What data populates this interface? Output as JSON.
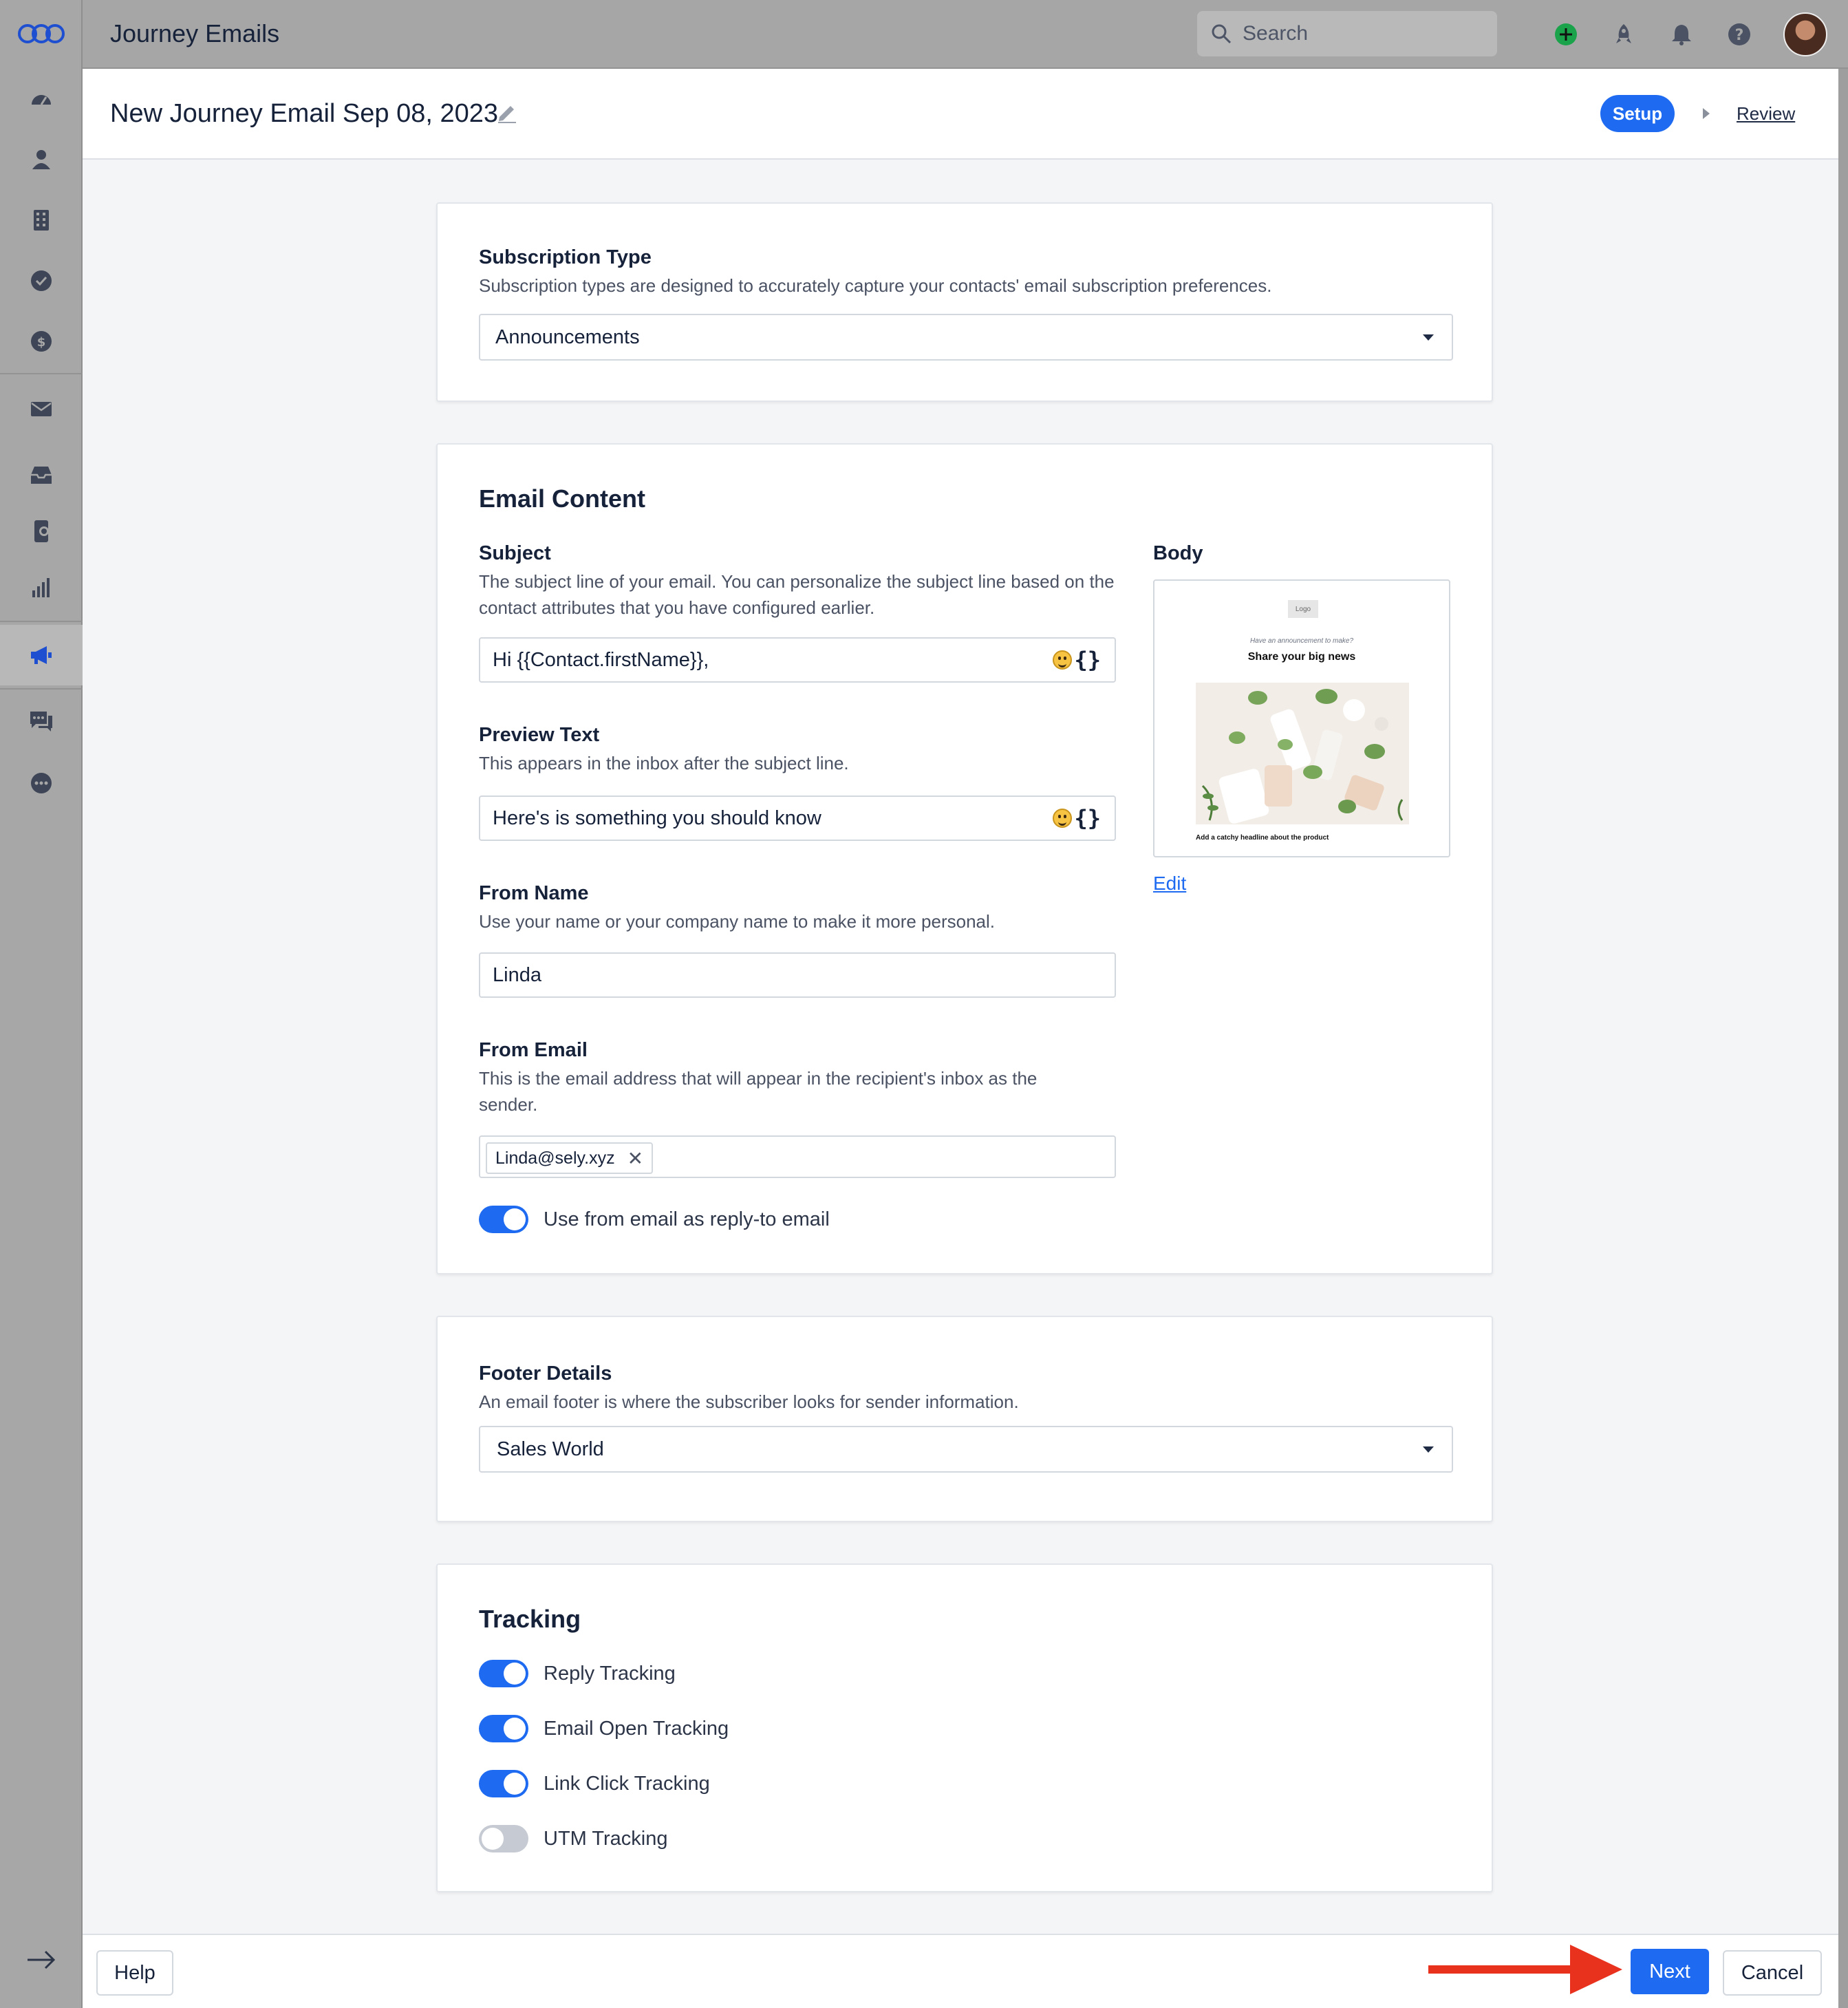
{
  "topbar": {
    "app_title": "Journey Emails",
    "search_placeholder": "Search",
    "icons": [
      "add-icon",
      "rocket-icon",
      "bell-icon",
      "help-icon",
      "avatar"
    ]
  },
  "sidebar": {
    "items": [
      "dashboard-icon",
      "contacts-icon",
      "accounts-icon",
      "tasks-icon",
      "deals-icon",
      "email-icon",
      "inbox-icon",
      "phone-icon",
      "reports-icon",
      "campaigns-icon",
      "chat-icon",
      "more-icon"
    ],
    "active": "campaigns-icon"
  },
  "header": {
    "title": "New Journey Email Sep 08, 2023",
    "steps": [
      "Setup",
      "Review"
    ],
    "active_step": "Setup"
  },
  "subscription": {
    "label": "Subscription Type",
    "help": "Subscription types are designed to accurately capture your contacts' email subscription preferences.",
    "value": "Announcements"
  },
  "email_content": {
    "title": "Email Content",
    "subject_label": "Subject",
    "subject_help": "The subject line of your email. You can personalize the subject line based on the contact attributes that you have configured earlier.",
    "subject_value": "Hi {{Contact.firstName}},",
    "preview_label": "Preview Text",
    "preview_help": "This appears in the inbox after the subject line.",
    "preview_value": "Here's is something you should know",
    "from_name_label": "From Name",
    "from_name_help": "Use your name or your company name to make it more personal.",
    "from_name_value": "Linda",
    "from_email_label": "From Email",
    "from_email_help": "This is the email address that will appear in the recipient's inbox as the sender.",
    "from_email_chip": "Linda@sely.xyz",
    "reply_to_label": "Use from email as reply-to email",
    "reply_to_on": true,
    "braces": "{}",
    "body_label": "Body",
    "body_preview": {
      "logo": "Logo",
      "subheading": "Have an announcement to make?",
      "heading": "Share your big news",
      "caption": "Add a catchy headline about the product"
    },
    "edit_link": "Edit"
  },
  "footer_details": {
    "label": "Footer Details",
    "help": "An email footer is where the subscriber looks for sender information.",
    "value": "Sales World"
  },
  "tracking": {
    "title": "Tracking",
    "items": [
      {
        "label": "Reply Tracking",
        "on": true
      },
      {
        "label": "Email Open Tracking",
        "on": true
      },
      {
        "label": "Link Click Tracking",
        "on": true
      },
      {
        "label": "UTM Tracking",
        "on": false
      }
    ]
  },
  "bottombar": {
    "help": "Help",
    "next": "Next",
    "cancel": "Cancel"
  },
  "colors": {
    "primary": "#1e6bf1",
    "annotation_arrow": "#e8321e",
    "add_icon": "#1aa34a"
  }
}
